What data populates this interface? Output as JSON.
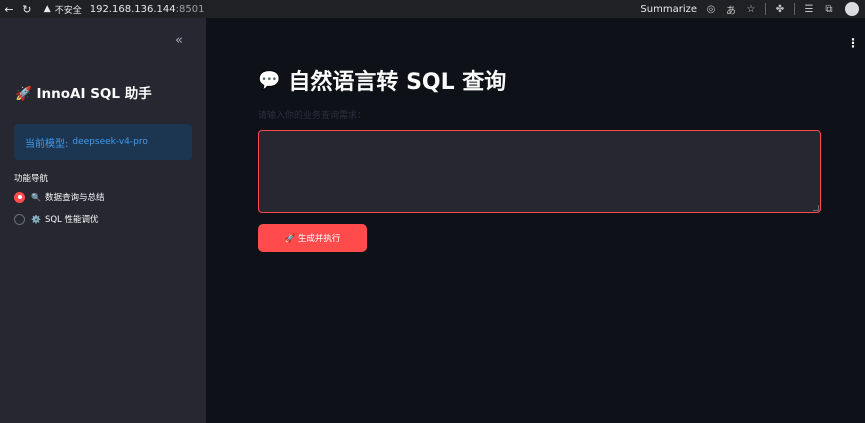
{
  "browser": {
    "back_icon": "arrow-left-icon",
    "reload_icon": "reload-icon",
    "security_label": "不安全",
    "url_host": "192.168.136.144",
    "url_port": ":8501",
    "summarize_label": "Summarize"
  },
  "sidebar": {
    "title": "🚀 InnoAI SQL 助手",
    "model_label": "当前模型:",
    "model_value": "deepseek-v4-pro",
    "nav_label": "功能导航",
    "nav_items": [
      {
        "emoji": "🔍",
        "label": "数据查询与总结",
        "selected": true
      },
      {
        "emoji": "⚙️",
        "label": "SQL 性能调优",
        "selected": false
      }
    ]
  },
  "main": {
    "title_emoji": "💬",
    "title": "自然语言转 SQL 查询",
    "field_label": "请输入你的业务查询需求：",
    "input_value": "",
    "run_button_label": "🚀 生成并执行"
  },
  "colors": {
    "accent": "#ff4b4b",
    "sidebar_bg": "#262730",
    "main_bg": "#0e1117",
    "info_bg": "#1c3550",
    "info_text": "#3d9df3"
  }
}
